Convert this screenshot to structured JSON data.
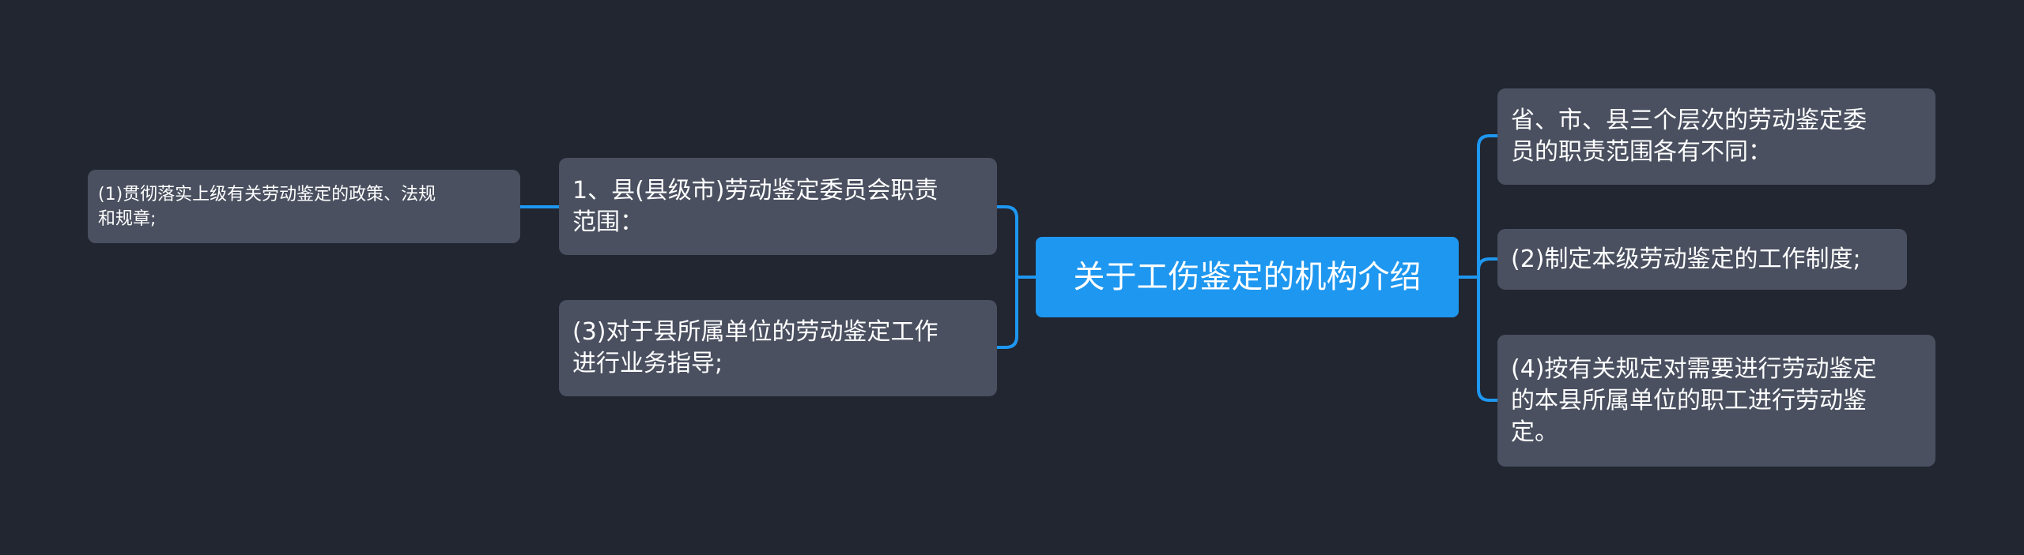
{
  "canvas": {
    "background_color": "#212631",
    "connector_color": "#1e97f0"
  },
  "root": {
    "label": "关于工伤鉴定的机构介绍",
    "color": "#1e97f0"
  },
  "left_branches": [
    {
      "label": "1、县(县级市)劳动鉴定委员会职责\n范围：",
      "children": [
        {
          "label": "(1)贯彻落实上级有关劳动鉴定的政策、法规\n和规章;"
        }
      ]
    },
    {
      "label": "(3)对于县所属单位的劳动鉴定工作\n进行业务指导;"
    }
  ],
  "right_branches": [
    {
      "label": "省、市、县三个层次的劳动鉴定委\n员的职责范围各有不同："
    },
    {
      "label": "(2)制定本级劳动鉴定的工作制度;"
    },
    {
      "label": "(4)按有关规定对需要进行劳动鉴定\n的本县所属单位的职工进行劳动鉴\n定。"
    }
  ]
}
